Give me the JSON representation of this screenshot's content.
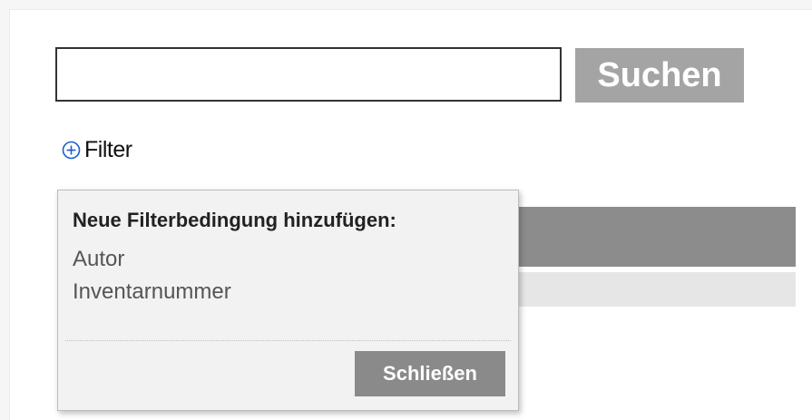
{
  "search": {
    "input_value": "",
    "button_label": "Suchen"
  },
  "filter": {
    "label": "Filter",
    "icon": "plus-circle-icon",
    "icon_color": "#1a5fd0"
  },
  "popup": {
    "title": "Neue Filterbedingung hinzufügen:",
    "options": [
      "Autor",
      "Inventarnummer"
    ],
    "close_label": "Schließen"
  },
  "colors": {
    "search_button": "#a4a4a4",
    "table_header": "#8c8c8c",
    "table_row": "#e6e6e6",
    "close_button": "#8a8a8a"
  }
}
